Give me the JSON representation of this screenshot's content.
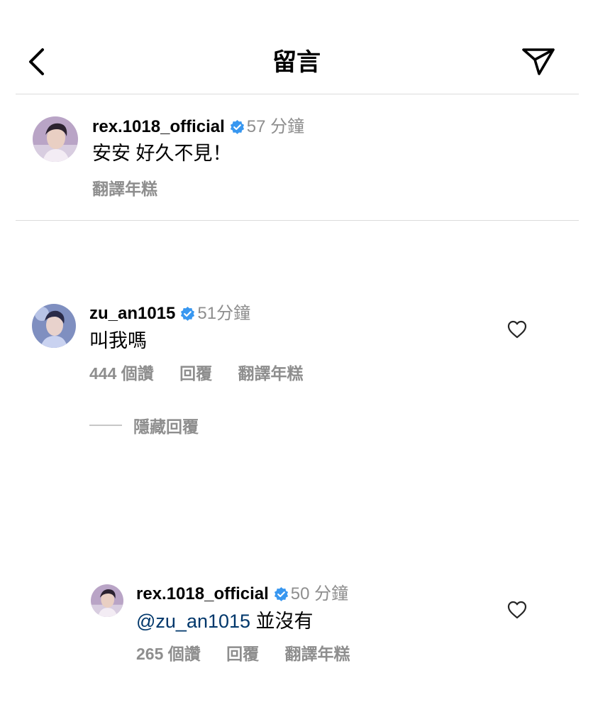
{
  "header": {
    "title": "留言",
    "back_icon": "chevron-left-icon",
    "share_icon": "paper-plane-icon"
  },
  "caption": {
    "username": "rex.1018_official",
    "verified": true,
    "time": "57 分鐘",
    "text": "安安 好久不見！",
    "translate": "翻譯年糕"
  },
  "comments": [
    {
      "username": "zu_an1015",
      "verified": true,
      "time": "51分鐘",
      "text": "叫我嗎",
      "likes": "444 個讚",
      "reply": "回覆",
      "translate": "翻譯年糕",
      "hide_replies": "隱藏回覆",
      "replies": [
        {
          "username": "rex.1018_official",
          "verified": true,
          "time": "50 分鐘",
          "mention": "@zu_an1015",
          "text": " 並沒有",
          "likes": "265 個讚",
          "reply": "回覆",
          "translate": "翻譯年糕"
        }
      ]
    }
  ],
  "colors": {
    "verified_badge": "#3897f0",
    "secondary_text": "#8e8e8e",
    "mention": "#00376b",
    "divider": "#dcdcdc"
  }
}
